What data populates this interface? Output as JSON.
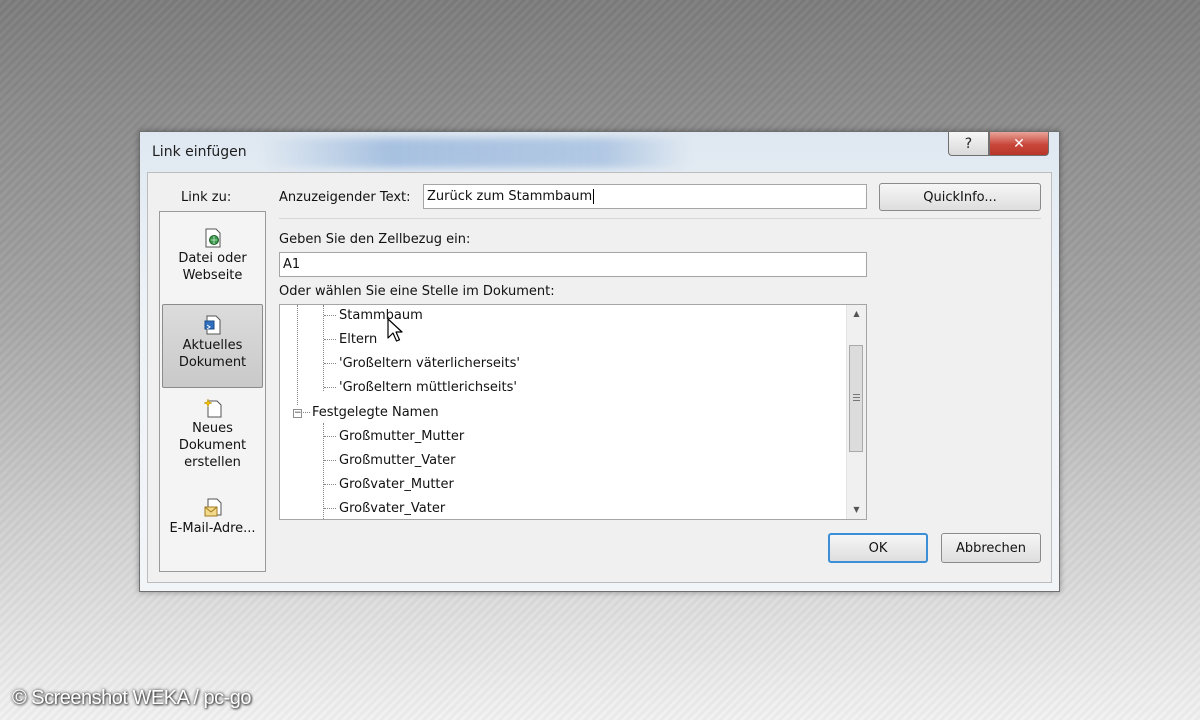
{
  "dialog": {
    "title": "Link einfügen",
    "help_glyph": "?",
    "close_glyph": "✕"
  },
  "sidebar": {
    "header": "Link zu:",
    "items": [
      {
        "line1": "Datei oder",
        "line2": "Webseite",
        "icon": "file-web-icon",
        "selected": false
      },
      {
        "line1": "Aktuelles",
        "line2": "Dokument",
        "icon": "current-document-icon",
        "selected": true
      },
      {
        "line1": "Neues",
        "line2": "Dokument",
        "line3": "erstellen",
        "icon": "new-document-icon",
        "selected": false
      },
      {
        "line1": "E-Mail-Adre...",
        "icon": "email-icon",
        "selected": false
      }
    ]
  },
  "display_text": {
    "label": "Anzuzeigender Text:",
    "value": "Zurück zum Stammbaum"
  },
  "quickinfo_button": "QuickInfo...",
  "cell_ref": {
    "label": "Geben Sie den Zellbezug ein:",
    "value": "A1"
  },
  "place_in_doc": {
    "label": "Oder wählen Sie eine Stelle im Dokument:",
    "items": [
      {
        "text": "Stammbaum",
        "level": 2
      },
      {
        "text": "Eltern",
        "level": 2
      },
      {
        "text": "'Großeltern väterlicherseits'",
        "level": 2
      },
      {
        "text": "'Großeltern müttlerichseits'",
        "level": 2
      },
      {
        "text": "Festgelegte Namen",
        "level": 1,
        "expanded": true,
        "expander": "−"
      },
      {
        "text": "Großmutter_Mutter",
        "level": 2
      },
      {
        "text": "Großmutter_Vater",
        "level": 2
      },
      {
        "text": "Großvater_Mutter",
        "level": 2
      },
      {
        "text": "Großvater_Vater",
        "level": 2
      }
    ],
    "scroll_up_glyph": "▲",
    "scroll_down_glyph": "▼"
  },
  "buttons": {
    "ok": "OK",
    "cancel": "Abbrechen"
  },
  "watermark": "© Screenshot WEKA / pc-go"
}
